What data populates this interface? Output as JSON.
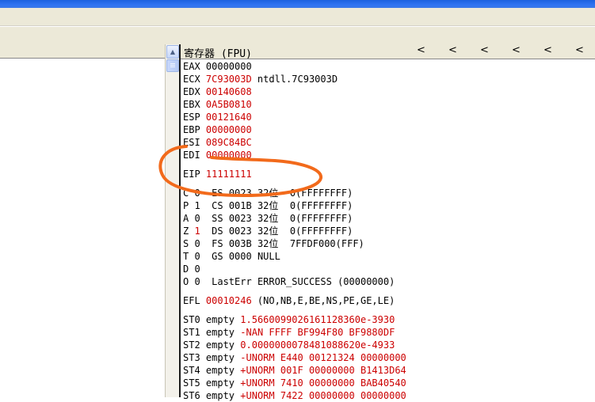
{
  "header": {
    "title": "寄存器 (FPU)",
    "arrows": [
      "<",
      "<",
      "<",
      "<",
      "<",
      "<"
    ]
  },
  "registers": [
    {
      "name": "EAX",
      "value": "00000000",
      "extra": "",
      "changed": false
    },
    {
      "name": "ECX",
      "value": "7C93003D",
      "extra": "ntdll.7C93003D",
      "changed": true
    },
    {
      "name": "EDX",
      "value": "00140608",
      "extra": "",
      "changed": true
    },
    {
      "name": "EBX",
      "value": "0A5B0810",
      "extra": "",
      "changed": true
    },
    {
      "name": "ESP",
      "value": "00121640",
      "extra": "",
      "changed": true
    },
    {
      "name": "EBP",
      "value": "00000000",
      "extra": "",
      "changed": true
    },
    {
      "name": "ESI",
      "value": "089C84BC",
      "extra": "",
      "changed": true
    },
    {
      "name": "EDI",
      "value": "00000000",
      "extra": "",
      "changed": true
    }
  ],
  "eip": {
    "name": "EIP",
    "value": "11111111"
  },
  "flags": [
    {
      "flag": "C",
      "bit": "0",
      "bit_changed": false,
      "seg": "ES",
      "sel": "0023",
      "bits": "32位",
      "desc": "0(FFFFFFFF)"
    },
    {
      "flag": "P",
      "bit": "1",
      "bit_changed": false,
      "seg": "CS",
      "sel": "001B",
      "bits": "32位",
      "desc": "0(FFFFFFFF)"
    },
    {
      "flag": "A",
      "bit": "0",
      "bit_changed": false,
      "seg": "SS",
      "sel": "0023",
      "bits": "32位",
      "desc": "0(FFFFFFFF)"
    },
    {
      "flag": "Z",
      "bit": "1",
      "bit_changed": true,
      "seg": "DS",
      "sel": "0023",
      "bits": "32位",
      "desc": "0(FFFFFFFF)"
    },
    {
      "flag": "S",
      "bit": "0",
      "bit_changed": false,
      "seg": "FS",
      "sel": "003B",
      "bits": "32位",
      "desc": "7FFDF000(FFF)"
    },
    {
      "flag": "T",
      "bit": "0",
      "bit_changed": false,
      "seg": "GS",
      "sel": "0000",
      "bits": "NULL",
      "desc": ""
    },
    {
      "flag": "D",
      "bit": "0",
      "bit_changed": false,
      "seg": "",
      "sel": "",
      "bits": "",
      "desc": ""
    },
    {
      "flag": "O",
      "bit": "0",
      "bit_changed": false,
      "seg": "LastErr",
      "sel": "ERROR_SUCCESS",
      "bits": "(00000000)",
      "desc": ""
    }
  ],
  "efl": {
    "name": "EFL",
    "value": "00010246",
    "desc": "(NO,NB,E,BE,NS,PE,GE,LE)"
  },
  "fpu": [
    {
      "name": "ST0",
      "tag": "empty",
      "value": "1.5660099026161128360e-3930"
    },
    {
      "name": "ST1",
      "tag": "empty",
      "value": "-NAN FFFF BF994F80 BF9880DF"
    },
    {
      "name": "ST2",
      "tag": "empty",
      "value": "0.0000000078481088620e-4933"
    },
    {
      "name": "ST3",
      "tag": "empty",
      "value": "-UNORM E440 00121324 00000000"
    },
    {
      "name": "ST4",
      "tag": "empty",
      "value": "+UNORM 001F 00000000 B1413D64"
    },
    {
      "name": "ST5",
      "tag": "empty",
      "value": "+UNORM 7410 00000000 BAB40540"
    },
    {
      "name": "ST6",
      "tag": "empty",
      "value": "+UNORM 7422 00000000 00000000"
    }
  ],
  "colors": {
    "changed": "#cc0000",
    "annotation": "#f26a1b",
    "titlebar": "#2f73f2"
  },
  "icons": {
    "scroll_up": "scroll-up-arrow-icon"
  }
}
